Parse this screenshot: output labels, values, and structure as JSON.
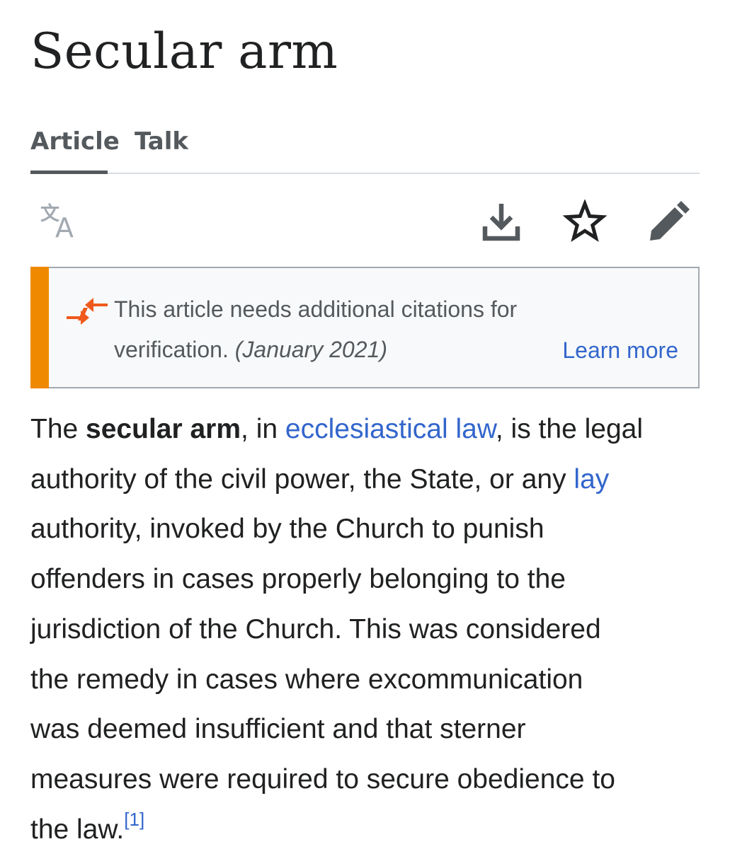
{
  "page": {
    "title": "Secular arm"
  },
  "tabs": [
    {
      "label": "Article",
      "active": true
    },
    {
      "label": "Talk",
      "active": false
    }
  ],
  "toolbar": {
    "language_icon": "translate-icon",
    "download_icon": "download-icon",
    "watch_icon": "star-icon",
    "edit_icon": "pencil-icon"
  },
  "notice": {
    "icon": "merge-arrows-icon",
    "text": "This article needs additional citations for verification.",
    "date": "(January 2021)",
    "link": "Learn more",
    "stripe_color": "#ef8a00"
  },
  "article": {
    "lines": [
      {
        "pre": "The ",
        "bold": "secular arm",
        "mid": ", in ",
        "link": "ecclesiastical law",
        "post": ", is the legal"
      },
      {
        "pre": "authority of the civil power, the State, or any ",
        "link": "lay"
      },
      "authority, invoked by the Church to punish",
      "offenders in cases properly belonging to the",
      "jurisdiction of the Church. This was considered",
      "the remedy in cases where excommunication",
      "was deemed insufficient and that sterner",
      "measures were required to secure obedience to",
      {
        "pre": "the law.",
        "ref": "[1]"
      }
    ]
  },
  "colors": {
    "text": "#202122",
    "link": "#3366cc",
    "tab_text": "#54595d",
    "notice_stripe": "#ef8a00",
    "notice_bg": "#f8f9fa"
  }
}
